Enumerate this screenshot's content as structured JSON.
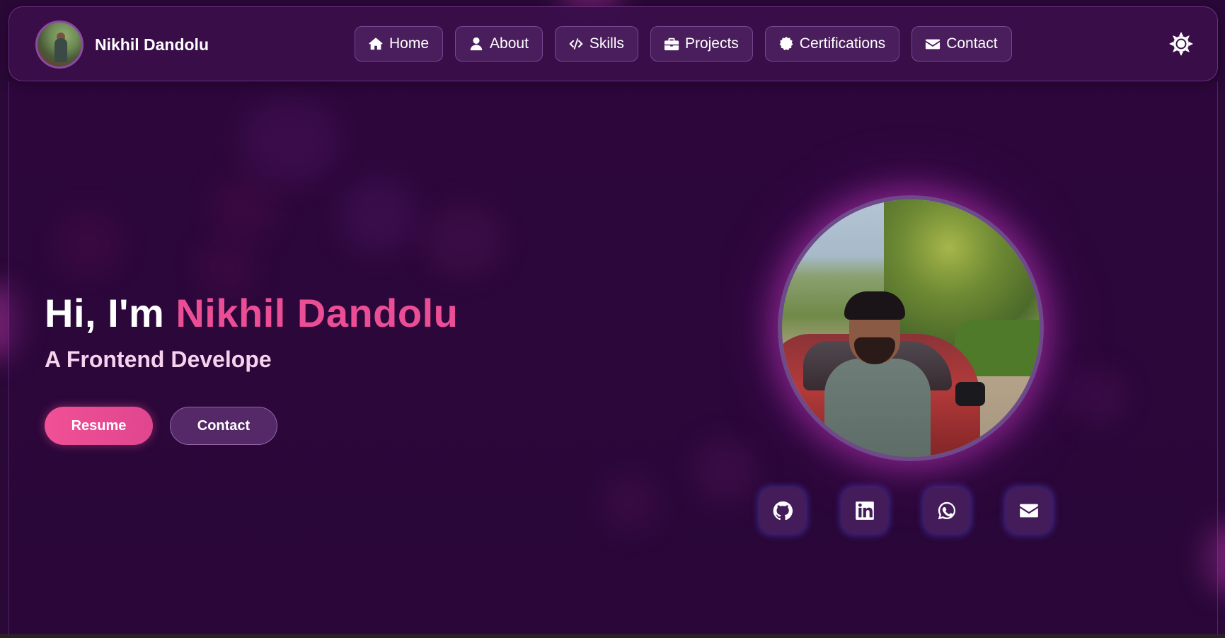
{
  "header": {
    "brand_name": "Nikhil Dandolu",
    "nav": [
      {
        "label": "Home",
        "icon": "home-icon"
      },
      {
        "label": "About",
        "icon": "user-icon"
      },
      {
        "label": "Skills",
        "icon": "code-icon"
      },
      {
        "label": "Projects",
        "icon": "briefcase-icon"
      },
      {
        "label": "Certifications",
        "icon": "certificate-icon"
      },
      {
        "label": "Contact",
        "icon": "envelope-icon"
      }
    ],
    "theme_toggle_icon": "sun-icon"
  },
  "hero": {
    "greeting": "Hi, I'm ",
    "name": "Nikhil Dandolu",
    "subtitle": "A Frontend Develope",
    "resume_label": "Resume",
    "contact_label": "Contact"
  },
  "socials": [
    {
      "icon": "github-icon"
    },
    {
      "icon": "linkedin-icon"
    },
    {
      "icon": "whatsapp-icon"
    },
    {
      "icon": "email-icon"
    }
  ],
  "colors": {
    "background": "#2a0838",
    "accent_pink": "#ec4e96",
    "subtitle": "#f6d2ee",
    "glow_blue": "#5a50e6"
  }
}
